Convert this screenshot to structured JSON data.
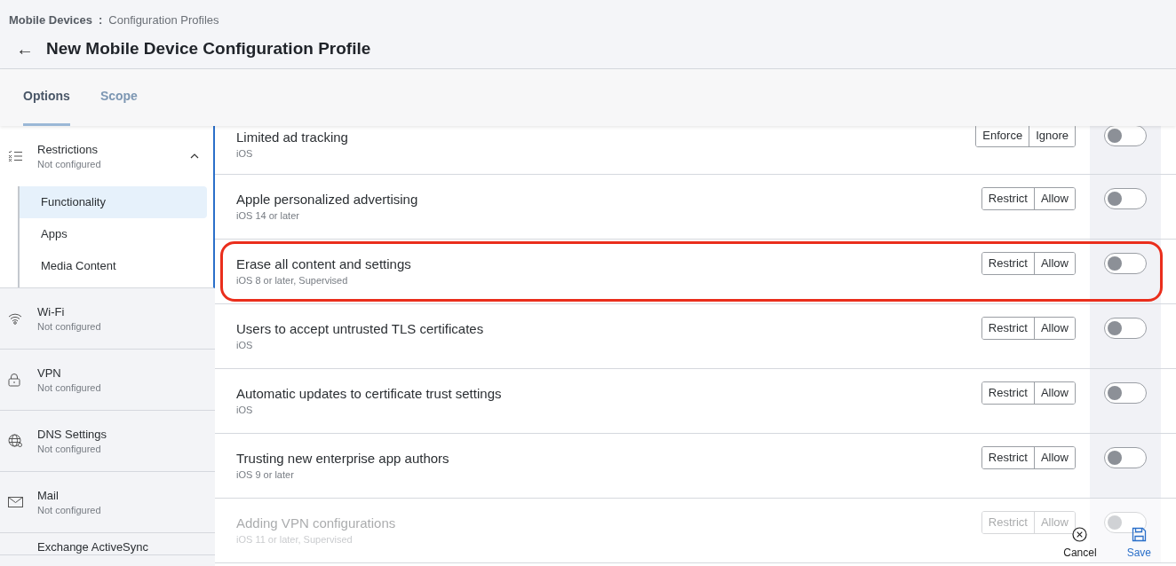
{
  "breadcrumb": {
    "parent": "Mobile Devices",
    "separator": ":",
    "current": "Configuration Profiles"
  },
  "back_icon": "←",
  "title": "New Mobile Device Configuration Profile",
  "tabs": [
    {
      "label": "Options",
      "selected": true
    },
    {
      "label": "Scope",
      "selected": false
    }
  ],
  "sidebar": {
    "items": [
      {
        "label": "Restrictions",
        "status": "Not configured",
        "kind": "list",
        "expanded": true,
        "children": [
          {
            "label": "Functionality",
            "selected": true
          },
          {
            "label": "Apps",
            "selected": false
          },
          {
            "label": "Media Content",
            "selected": false
          }
        ]
      },
      {
        "label": "Wi-Fi",
        "status": "Not configured",
        "kind": "wifi",
        "expanded": false
      },
      {
        "label": "VPN",
        "status": "Not configured",
        "kind": "lock",
        "expanded": false
      },
      {
        "label": "DNS Settings",
        "status": "Not configured",
        "kind": "globe",
        "expanded": false
      },
      {
        "label": "Mail",
        "status": "Not configured",
        "kind": "mail",
        "expanded": false
      },
      {
        "label": "Exchange ActiveSync",
        "kind": "plain",
        "expanded": false
      }
    ]
  },
  "settings": [
    {
      "title": "Limited ad tracking",
      "subtitle": "iOS",
      "options": [
        "Enforce",
        "Ignore"
      ],
      "on": false,
      "highlighted": false,
      "disabled": false
    },
    {
      "title": "Apple personalized advertising",
      "subtitle": "iOS 14 or later",
      "options": [
        "Restrict",
        "Allow"
      ],
      "on": false,
      "highlighted": false,
      "disabled": false
    },
    {
      "title": "Erase all content and settings",
      "subtitle": "iOS 8 or later, Supervised",
      "options": [
        "Restrict",
        "Allow"
      ],
      "on": false,
      "highlighted": true,
      "disabled": false
    },
    {
      "title": "Users to accept untrusted TLS certificates",
      "subtitle": "iOS",
      "options": [
        "Restrict",
        "Allow"
      ],
      "on": false,
      "highlighted": false,
      "disabled": false
    },
    {
      "title": "Automatic updates to certificate trust settings",
      "subtitle": "iOS",
      "options": [
        "Restrict",
        "Allow"
      ],
      "on": false,
      "highlighted": false,
      "disabled": false
    },
    {
      "title": "Trusting new enterprise app authors",
      "subtitle": "iOS 9 or later",
      "options": [
        "Restrict",
        "Allow"
      ],
      "on": false,
      "highlighted": false,
      "disabled": false
    },
    {
      "title": "Adding VPN configurations",
      "subtitle": "iOS 11 or later, Supervised",
      "options": [
        "Restrict",
        "Allow"
      ],
      "on": false,
      "highlighted": false,
      "disabled": true
    }
  ],
  "footer": {
    "cancel": "Cancel",
    "save": "Save"
  }
}
